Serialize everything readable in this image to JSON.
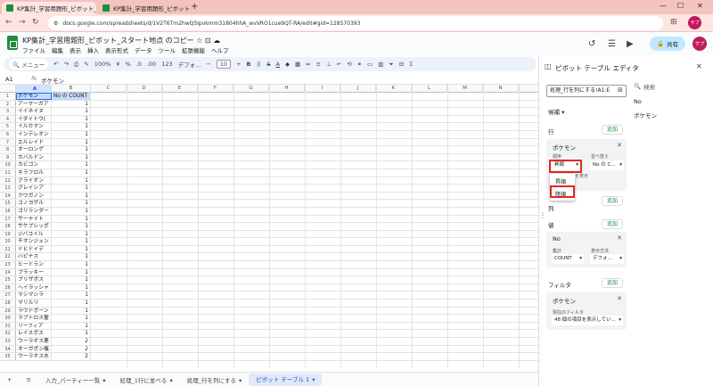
{
  "browser": {
    "tabs": [
      {
        "title": "KP集計_学習用題形_ピボット_スタ",
        "active": true
      },
      {
        "title": "KP集計_学習用題形_ピボット_スタ",
        "active": false
      }
    ],
    "url": "docs.google.com/spreadsheets/d/1V2T6Tm2hwQ5Ipvkmm31804hhA_wvVRO1cue9QT-RA/edit#gid=128570393",
    "profile_initials": "サプ"
  },
  "sheets": {
    "doc_title": "KP集計_学習用題形_ピボット_スタート地点 のコピー",
    "menu": [
      "ファイル",
      "編集",
      "表示",
      "挿入",
      "表示形式",
      "データ",
      "ツール",
      "拡張機能",
      "ヘルプ"
    ],
    "share_label": "共有",
    "avatar_initials": "サプ",
    "toolbar": {
      "menus_label": "メニュー",
      "zoom": "100%",
      "currency": "¥",
      "percent": "%",
      "dec_less": ".0",
      "dec_more": ".00",
      "num_format": "123",
      "font": "デフォ...",
      "font_size": "10"
    },
    "formula": {
      "cell_ref": "A1",
      "fx": "fx",
      "value": "ポケモン"
    },
    "columns": [
      "A",
      "B",
      "C",
      "D",
      "E",
      "F",
      "G",
      "H",
      "I",
      "J",
      "K",
      "L",
      "M",
      "N"
    ],
    "rows": [
      {
        "n": "1",
        "a": "ポケモン",
        "b": "No の COUNT"
      },
      {
        "n": "2",
        "a": "アーマーガア",
        "b": "1"
      },
      {
        "n": "3",
        "a": "イイネイヌ",
        "b": "1"
      },
      {
        "n": "4",
        "a": "イダイトウ(",
        "b": "1"
      },
      {
        "n": "5",
        "a": "イルカマン",
        "b": "1"
      },
      {
        "n": "6",
        "a": "インテレオン",
        "b": "1"
      },
      {
        "n": "7",
        "a": "エルレイド",
        "b": "1"
      },
      {
        "n": "8",
        "a": "オーロンゲ",
        "b": "1"
      },
      {
        "n": "9",
        "a": "カバルドン",
        "b": "1"
      },
      {
        "n": "10",
        "a": "カビゴン",
        "b": "1"
      },
      {
        "n": "11",
        "a": "キラフロル",
        "b": "1"
      },
      {
        "n": "12",
        "a": "グライオン",
        "b": "1"
      },
      {
        "n": "13",
        "a": "グレイシア",
        "b": "1"
      },
      {
        "n": "14",
        "a": "クワガノン",
        "b": "1"
      },
      {
        "n": "15",
        "a": "コノヨザル",
        "b": "1"
      },
      {
        "n": "16",
        "a": "ゴリランダー",
        "b": "1"
      },
      {
        "n": "17",
        "a": "サーナイト",
        "b": "1"
      },
      {
        "n": "18",
        "a": "サケブシッポ",
        "b": "1"
      },
      {
        "n": "19",
        "a": "ジバコイル",
        "b": "1"
      },
      {
        "n": "20",
        "a": "チオンジェン",
        "b": "1"
      },
      {
        "n": "21",
        "a": "ドヒドイデ",
        "b": "1"
      },
      {
        "n": "22",
        "a": "ハピナス",
        "b": "1"
      },
      {
        "n": "23",
        "a": "ヒードラン",
        "b": "1"
      },
      {
        "n": "24",
        "a": "ブラッキー",
        "b": "1"
      },
      {
        "n": "25",
        "a": "ブリザポス",
        "b": "1"
      },
      {
        "n": "26",
        "a": "ヘイラッシャ",
        "b": "1"
      },
      {
        "n": "27",
        "a": "マシマシラ",
        "b": "1"
      },
      {
        "n": "28",
        "a": "マリルリ",
        "b": "1"
      },
      {
        "n": "29",
        "a": "ラウドボーン",
        "b": "1"
      },
      {
        "n": "30",
        "a": "ラブトロス霊",
        "b": "1"
      },
      {
        "n": "31",
        "a": "リーフィア",
        "b": "1"
      },
      {
        "n": "32",
        "a": "レイスポス",
        "b": "1"
      },
      {
        "n": "33",
        "a": "ウーラオス悪",
        "b": "2"
      },
      {
        "n": "34",
        "a": "オーガポン竈",
        "b": "2"
      },
      {
        "n": "35",
        "a": "ウーラオス水",
        "b": "2"
      }
    ],
    "sheet_tabs": [
      {
        "label": "入力_パーティー一覧",
        "active": false
      },
      {
        "label": "処理_1行に並べる",
        "active": false
      },
      {
        "label": "処理_行を列にする",
        "active": false
      },
      {
        "label": "ピボット テーブル 1",
        "active": true
      }
    ]
  },
  "pivot": {
    "title": "ピボット テーブル エディタ",
    "range": "処理_行を列にする!A1:E",
    "search_placeholder": "検索",
    "fields": [
      "No",
      "ポケモン"
    ],
    "suggest_label": "候補",
    "rows_label": "行",
    "cols_label": "列",
    "values_label": "値",
    "filters_label": "フィルタ",
    "add_label": "追加",
    "row_card": {
      "title": "ポケモン",
      "order_label": "順序",
      "order_value": "昇順",
      "sort_by_label": "並べ替え",
      "sort_by_value": "No の C...",
      "show_totals": "合計を表示",
      "dropdown_options": [
        "昇順",
        "降順"
      ]
    },
    "value_card": {
      "title": "No",
      "summarize_label": "集計",
      "summarize_value": "COUNT",
      "show_as_label": "表示方法",
      "show_as_value": "デフォ..."
    },
    "filter_card": {
      "title": "ポケモン",
      "status_label": "現在のフィルタ",
      "status_value": "48 個の項目を表示してい..."
    }
  }
}
